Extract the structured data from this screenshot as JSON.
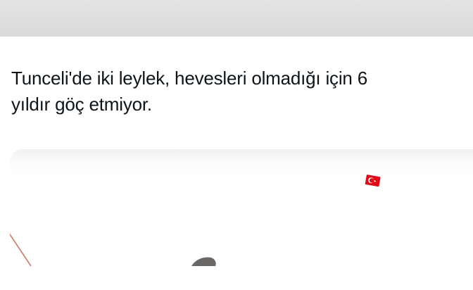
{
  "post": {
    "text_line_1": "Tunceli'de iki leylek, hevesleri olmadığı için 6",
    "text_line_2": "yıldır göç etmiyor."
  },
  "media": {
    "flag_icon": "turkish-flag-icon",
    "colors": {
      "flag_red": "#e30a17",
      "background": "#ffffff",
      "top_bar": "#dcdcdc"
    }
  }
}
